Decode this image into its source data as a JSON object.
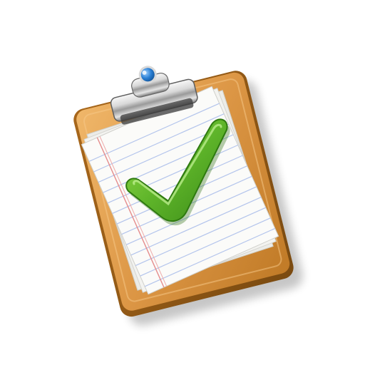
{
  "icon": {
    "name": "clipboard-checkmark-icon",
    "colors": {
      "background": "#ffffff",
      "board_light": "#e9a85a",
      "board_dark": "#b8741f",
      "board_edge": "#8a5514",
      "paper": "#fbfbf9",
      "paper_shadow": "#d9d9d4",
      "ruled_line": "#aebfe8",
      "margin_line": "#e58c8c",
      "clip_metal_light": "#f4f4f4",
      "clip_metal_dark": "#6f6f6f",
      "clip_gem": "#2a7fd4",
      "check_light": "#7fcf3a",
      "check_dark": "#3f8f1b"
    }
  }
}
